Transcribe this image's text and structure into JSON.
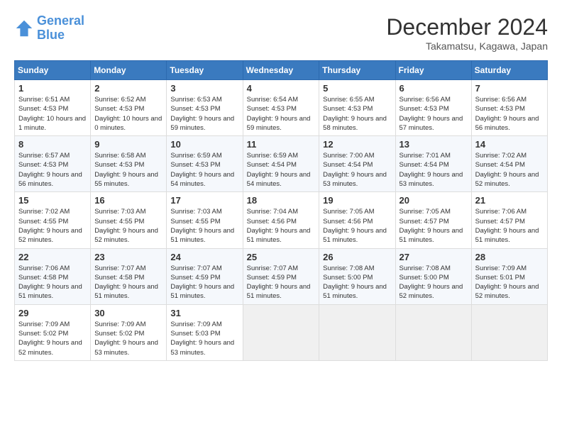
{
  "header": {
    "logo_line1": "General",
    "logo_line2": "Blue",
    "month_year": "December 2024",
    "location": "Takamatsu, Kagawa, Japan"
  },
  "days_of_week": [
    "Sunday",
    "Monday",
    "Tuesday",
    "Wednesday",
    "Thursday",
    "Friday",
    "Saturday"
  ],
  "weeks": [
    [
      {
        "day": "1",
        "rise": "6:51 AM",
        "set": "4:53 PM",
        "daylight": "10 hours and 1 minute."
      },
      {
        "day": "2",
        "rise": "6:52 AM",
        "set": "4:53 PM",
        "daylight": "10 hours and 0 minutes."
      },
      {
        "day": "3",
        "rise": "6:53 AM",
        "set": "4:53 PM",
        "daylight": "9 hours and 59 minutes."
      },
      {
        "day": "4",
        "rise": "6:54 AM",
        "set": "4:53 PM",
        "daylight": "9 hours and 59 minutes."
      },
      {
        "day": "5",
        "rise": "6:55 AM",
        "set": "4:53 PM",
        "daylight": "9 hours and 58 minutes."
      },
      {
        "day": "6",
        "rise": "6:56 AM",
        "set": "4:53 PM",
        "daylight": "9 hours and 57 minutes."
      },
      {
        "day": "7",
        "rise": "6:56 AM",
        "set": "4:53 PM",
        "daylight": "9 hours and 56 minutes."
      }
    ],
    [
      {
        "day": "8",
        "rise": "6:57 AM",
        "set": "4:53 PM",
        "daylight": "9 hours and 56 minutes."
      },
      {
        "day": "9",
        "rise": "6:58 AM",
        "set": "4:53 PM",
        "daylight": "9 hours and 55 minutes."
      },
      {
        "day": "10",
        "rise": "6:59 AM",
        "set": "4:53 PM",
        "daylight": "9 hours and 54 minutes."
      },
      {
        "day": "11",
        "rise": "6:59 AM",
        "set": "4:54 PM",
        "daylight": "9 hours and 54 minutes."
      },
      {
        "day": "12",
        "rise": "7:00 AM",
        "set": "4:54 PM",
        "daylight": "9 hours and 53 minutes."
      },
      {
        "day": "13",
        "rise": "7:01 AM",
        "set": "4:54 PM",
        "daylight": "9 hours and 53 minutes."
      },
      {
        "day": "14",
        "rise": "7:02 AM",
        "set": "4:54 PM",
        "daylight": "9 hours and 52 minutes."
      }
    ],
    [
      {
        "day": "15",
        "rise": "7:02 AM",
        "set": "4:55 PM",
        "daylight": "9 hours and 52 minutes."
      },
      {
        "day": "16",
        "rise": "7:03 AM",
        "set": "4:55 PM",
        "daylight": "9 hours and 52 minutes."
      },
      {
        "day": "17",
        "rise": "7:03 AM",
        "set": "4:55 PM",
        "daylight": "9 hours and 51 minutes."
      },
      {
        "day": "18",
        "rise": "7:04 AM",
        "set": "4:56 PM",
        "daylight": "9 hours and 51 minutes."
      },
      {
        "day": "19",
        "rise": "7:05 AM",
        "set": "4:56 PM",
        "daylight": "9 hours and 51 minutes."
      },
      {
        "day": "20",
        "rise": "7:05 AM",
        "set": "4:57 PM",
        "daylight": "9 hours and 51 minutes."
      },
      {
        "day": "21",
        "rise": "7:06 AM",
        "set": "4:57 PM",
        "daylight": "9 hours and 51 minutes."
      }
    ],
    [
      {
        "day": "22",
        "rise": "7:06 AM",
        "set": "4:58 PM",
        "daylight": "9 hours and 51 minutes."
      },
      {
        "day": "23",
        "rise": "7:07 AM",
        "set": "4:58 PM",
        "daylight": "9 hours and 51 minutes."
      },
      {
        "day": "24",
        "rise": "7:07 AM",
        "set": "4:59 PM",
        "daylight": "9 hours and 51 minutes."
      },
      {
        "day": "25",
        "rise": "7:07 AM",
        "set": "4:59 PM",
        "daylight": "9 hours and 51 minutes."
      },
      {
        "day": "26",
        "rise": "7:08 AM",
        "set": "5:00 PM",
        "daylight": "9 hours and 51 minutes."
      },
      {
        "day": "27",
        "rise": "7:08 AM",
        "set": "5:00 PM",
        "daylight": "9 hours and 52 minutes."
      },
      {
        "day": "28",
        "rise": "7:09 AM",
        "set": "5:01 PM",
        "daylight": "9 hours and 52 minutes."
      }
    ],
    [
      {
        "day": "29",
        "rise": "7:09 AM",
        "set": "5:02 PM",
        "daylight": "9 hours and 52 minutes."
      },
      {
        "day": "30",
        "rise": "7:09 AM",
        "set": "5:02 PM",
        "daylight": "9 hours and 53 minutes."
      },
      {
        "day": "31",
        "rise": "7:09 AM",
        "set": "5:03 PM",
        "daylight": "9 hours and 53 minutes."
      },
      null,
      null,
      null,
      null
    ]
  ]
}
